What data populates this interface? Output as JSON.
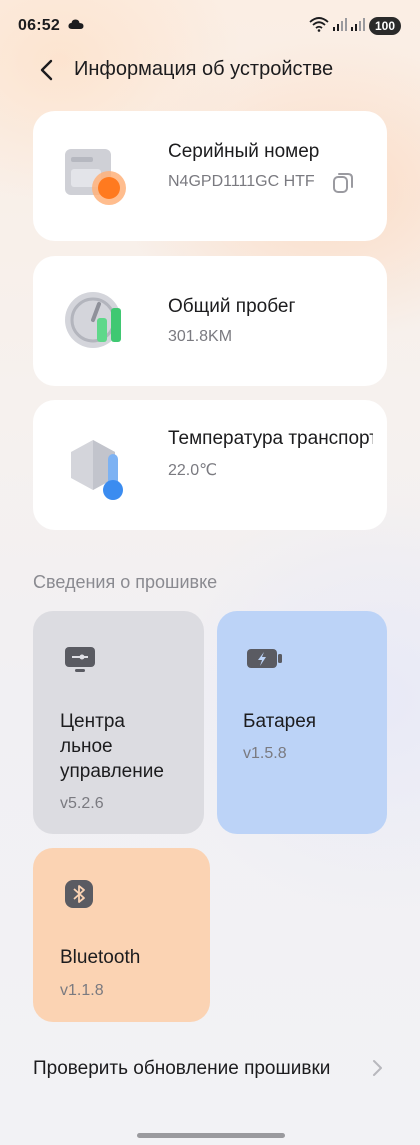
{
  "status_bar": {
    "time": "06:52",
    "battery": "100"
  },
  "header": {
    "title": "Информация об устройстве"
  },
  "cards": [
    {
      "label": "Серийный номер",
      "value": "N4GPD1111GC HTF",
      "icon": "serial-number-icon",
      "accent": "#ff8a2b"
    },
    {
      "label": "Общий пробег",
      "value": "301.8KM",
      "icon": "odometer-icon",
      "accent": "#46d17a"
    },
    {
      "label": "Температура транспортного сре…",
      "value": "22.0℃",
      "icon": "thermometer-icon",
      "accent": "#3b8cf0"
    }
  ],
  "firmware": {
    "section_title": "Сведения о прошивке",
    "items": [
      {
        "name": "Центра\nльное\nуправление",
        "version": "v5.2.6",
        "icon": "controller-icon",
        "color": "#dcdce0"
      },
      {
        "name": "Батарея",
        "version": "v1.5.8",
        "icon": "battery-icon",
        "color": "#bcd3f7"
      },
      {
        "name": "Bluetooth",
        "version": "v1.1.8",
        "icon": "bluetooth-icon",
        "color": "#fbd3b3"
      }
    ]
  },
  "update": {
    "label": "Проверить обновление прошивки"
  }
}
